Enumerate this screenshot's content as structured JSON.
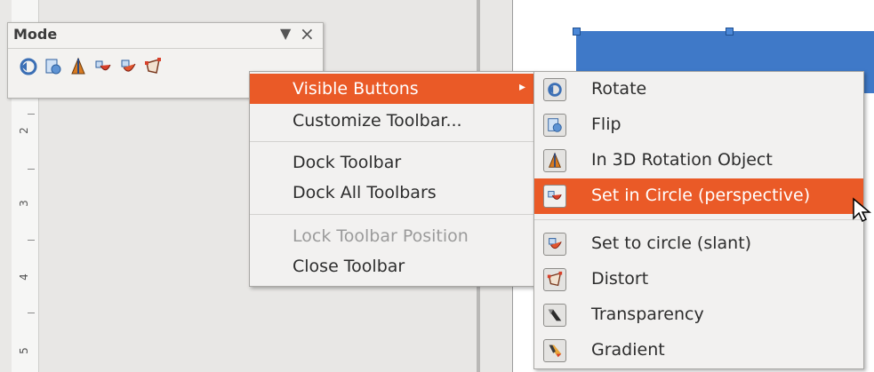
{
  "ruler": {
    "numbers": [
      "2",
      "3",
      "4",
      "5"
    ]
  },
  "toolbar": {
    "title": "Mode",
    "dropdown_glyph": "▼",
    "close_glyph": "×",
    "icons": [
      "rotate-icon",
      "flip-icon",
      "in-3d-rotation-object-icon",
      "set-in-circle-perspective-icon",
      "set-to-circle-slant-icon",
      "distort-icon"
    ]
  },
  "context_menu": {
    "items": [
      {
        "label": "Visible Buttons",
        "highlighted": true,
        "has_submenu": true
      },
      {
        "label": "Customize Toolbar..."
      },
      {
        "label": "Dock Toolbar"
      },
      {
        "label": "Dock All Toolbars"
      },
      {
        "label": "Lock Toolbar Position",
        "disabled": true
      },
      {
        "label": "Close Toolbar"
      }
    ],
    "submenu_arrow": "▸"
  },
  "submenu": {
    "items": [
      {
        "label": "Rotate",
        "icon": "rotate-icon"
      },
      {
        "label": "Flip",
        "icon": "flip-icon"
      },
      {
        "label": "In 3D Rotation Object",
        "icon": "in-3d-rotation-object-icon"
      },
      {
        "label": "Set in Circle (perspective)",
        "icon": "set-in-circle-perspective-icon",
        "highlighted": true
      },
      {
        "label": "Set to circle (slant)",
        "icon": "set-to-circle-slant-icon"
      },
      {
        "label": "Distort",
        "icon": "distort-icon"
      },
      {
        "label": "Transparency",
        "icon": "transparency-icon"
      },
      {
        "label": "Gradient",
        "icon": "gradient-icon"
      }
    ]
  },
  "colors": {
    "highlight": "#ea5a27",
    "selection_blue": "#3f79c8"
  }
}
